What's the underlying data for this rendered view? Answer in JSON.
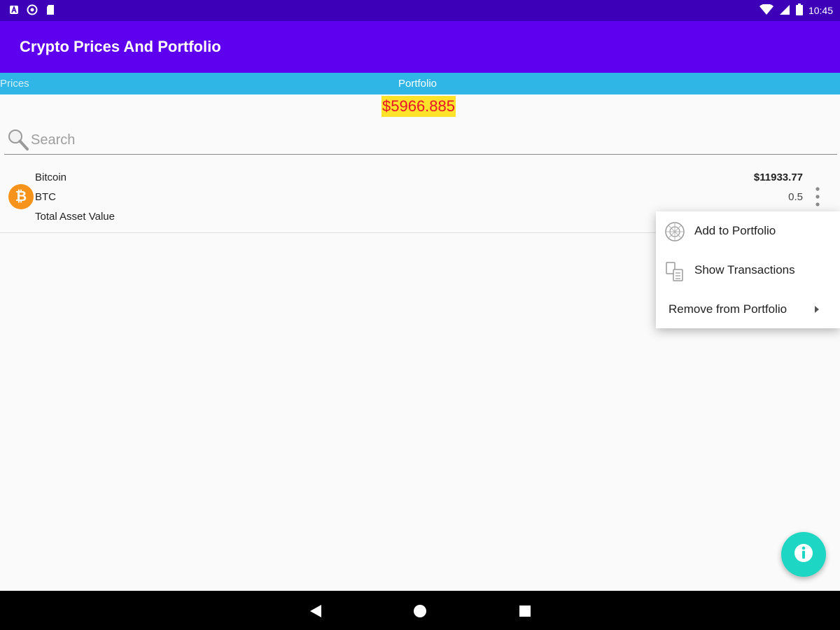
{
  "status_bar": {
    "time": "10:45",
    "left_icons": [
      "a-notification-icon",
      "circle-notification-icon",
      "sd-card-icon"
    ],
    "right_icons": [
      "wifi-icon",
      "signal-icon",
      "battery-icon"
    ]
  },
  "app_bar": {
    "title": "Crypto Prices And Portfolio"
  },
  "tabs": [
    {
      "label": "Prices",
      "selected": false
    },
    {
      "label": "Portfolio",
      "selected": true
    }
  ],
  "portfolio": {
    "total_value": "$5966.885"
  },
  "search": {
    "placeholder": "Search",
    "value": "",
    "icon": "search-icon"
  },
  "holdings": [
    {
      "name": "Bitcoin",
      "symbol": "BTC",
      "price": "$11933.77",
      "quantity": "0.5",
      "value_label": "Total Asset Value",
      "icon": "bitcoin-icon",
      "icon_glyph": "₿"
    }
  ],
  "context_menu": {
    "items": [
      {
        "label": "Add to Portfolio",
        "icon": "add-portfolio-icon"
      },
      {
        "label": "Show Transactions",
        "icon": "transactions-icon"
      },
      {
        "label": "Remove from Portfolio",
        "icon": "submenu-arrow-icon"
      }
    ]
  },
  "fab": {
    "icon": "info-icon"
  },
  "nav_bar": {
    "buttons": [
      "back-icon",
      "home-icon",
      "recents-icon"
    ]
  },
  "colors": {
    "status_bar": "#3d00b8",
    "app_bar": "#5e00ef",
    "tab_bar": "#2fb6e6",
    "total_bg": "#ffe32b",
    "total_text": "#e8122a",
    "bitcoin": "#f7931a",
    "fab": "#1dd7c4"
  }
}
